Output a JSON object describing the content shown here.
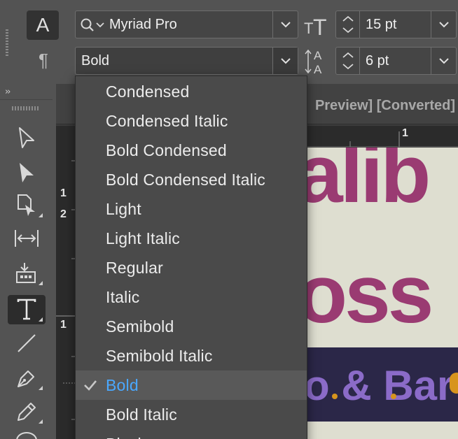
{
  "control_panel": {
    "character_mode_glyph": "A",
    "paragraph_mode_glyph": "¶",
    "font_family": "Myriad Pro",
    "font_style": "Bold",
    "font_size": "15 pt",
    "leading": "6 pt"
  },
  "tool_panel": {
    "collapse_glyph": "››",
    "tools": [
      {
        "name": "selection-tool",
        "icon": "arrow-outline-icon"
      },
      {
        "name": "direct-selection-tool",
        "icon": "arrow-filled-icon"
      },
      {
        "name": "page-tool",
        "icon": "page-icon"
      },
      {
        "name": "gap-tool",
        "icon": "gap-icon"
      },
      {
        "name": "content-collector-tool",
        "icon": "content-collector-icon"
      },
      {
        "name": "type-tool",
        "icon": "type-icon",
        "active": true
      },
      {
        "name": "line-tool",
        "icon": "line-icon"
      },
      {
        "name": "pen-tool",
        "icon": "pen-icon"
      },
      {
        "name": "pencil-tool",
        "icon": "pencil-icon"
      }
    ]
  },
  "document": {
    "tab_title": "Preview] [Converted]",
    "ruler_top_numbers": [
      "1"
    ],
    "ruler_left_numbers": [
      "1",
      "2",
      "1"
    ],
    "page_text_line1": "alib",
    "page_text_line2": "oss",
    "page_text_line3": "o & Bar"
  },
  "font_style_menu": {
    "selected": "Bold",
    "items": [
      "Condensed",
      "Condensed Italic",
      "Bold Condensed",
      "Bold Condensed Italic",
      "Light",
      "Light Italic",
      "Regular",
      "Italic",
      "Semibold",
      "Semibold Italic",
      "Bold",
      "Bold Italic",
      "Black"
    ]
  },
  "colors": {
    "accent_blue": "#4aa8ff",
    "panel_bg": "#535353",
    "page_magenta": "#9a3b72",
    "page_purple": "#8b6bc8",
    "page_orange": "#d7941d"
  }
}
